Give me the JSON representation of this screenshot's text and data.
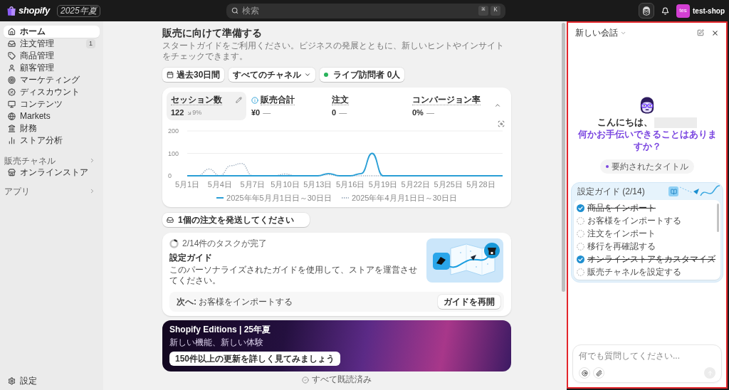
{
  "top_bar": {
    "logo": "shopify",
    "edition": "2025年夏",
    "search": {
      "placeholder": "検索",
      "keys": [
        "⌘",
        "K"
      ]
    },
    "avatar": "tes",
    "store": "test-shop"
  },
  "sidebar": {
    "items": [
      {
        "label": "ホーム",
        "selected": true
      },
      {
        "label": "注文管理",
        "selected": false,
        "badge": "1"
      },
      {
        "label": "商品管理",
        "selected": false
      },
      {
        "label": "顧客管理",
        "selected": false
      },
      {
        "label": "マーケティング",
        "selected": false
      },
      {
        "label": "ディスカウント",
        "selected": false
      },
      {
        "label": "コンテンツ",
        "selected": false
      },
      {
        "label": "Markets",
        "selected": false
      },
      {
        "label": "財務",
        "selected": false
      },
      {
        "label": "ストア分析",
        "selected": false
      }
    ],
    "sections": [
      {
        "title": "販売チャネル",
        "items": [
          {
            "label": "オンラインストア",
            "selected": false
          }
        ]
      },
      {
        "title": "アプリ"
      }
    ],
    "settings": {
      "label": "設定",
      "selected": false
    }
  },
  "main": {
    "title": "販売に向けて準備する",
    "subtitle": "スタートガイドをご利用ください。ビジネスの発展とともに、新しいヒントやインサイトをチェックできます。",
    "filters": [
      {
        "kind": "date",
        "label": "過去30日間"
      },
      {
        "kind": "dropdown",
        "label": "すべてのチャネル"
      },
      {
        "kind": "live",
        "label": "ライブ訪問者 0人"
      }
    ],
    "metrics": [
      {
        "label": "セッション数",
        "value": "122",
        "falling": true,
        "change": "9%",
        "selected": true
      },
      {
        "label": "販売合計",
        "info": true,
        "value": "¥0",
        "change": "—",
        "selected": false
      },
      {
        "label": "注文",
        "value": "0",
        "change": "—",
        "selected": false
      },
      {
        "label": "コンバージョン率",
        "value": "0%",
        "change": "—",
        "selected": false
      }
    ],
    "chart_data": {
      "type": "line",
      "categories": [
        "5月1日",
        null,
        null,
        "5月4日",
        null,
        null,
        "5月7日",
        null,
        null,
        "5月10日",
        null,
        null,
        "5月13日",
        null,
        null,
        "5月16日",
        null,
        null,
        "5月19日",
        null,
        null,
        "5月22日",
        null,
        null,
        "5月25日",
        null,
        null,
        "5月28日",
        null,
        null
      ],
      "ylim": [
        0,
        200
      ],
      "yticks": [
        0,
        100,
        200
      ],
      "series": [
        {
          "name": "2025年年5月月1日日～30日日",
          "color": "#2a9fd6",
          "line_style": "solid",
          "values": [
            0,
            0,
            0,
            0,
            0,
            0,
            0,
            0,
            0,
            0,
            0,
            0,
            0,
            10,
            0,
            0,
            10,
            100,
            0,
            0,
            0,
            0,
            0,
            0,
            0,
            0,
            0,
            0,
            0,
            0
          ]
        },
        {
          "name": "2025年年4月月1日日～30日日",
          "color": "#a9b7c6",
          "line_style": "dotted",
          "values": [
            0,
            0,
            30,
            0,
            45,
            55,
            0,
            0,
            0,
            8,
            0,
            0,
            0,
            5,
            0,
            0,
            0,
            0,
            0,
            null,
            null,
            null,
            null,
            null,
            null,
            null,
            null,
            null,
            null,
            null
          ]
        }
      ]
    },
    "notice": "1個の注文を発送してください",
    "setup_guide": {
      "progress": "2/14件のタスクが完了",
      "level": 0.14,
      "title": "設定ガイド",
      "description": "このパーソナライズされたガイドを使用して、ストアを運営させてください。",
      "next": "**次へ:** お客様をインポートする",
      "button": "ガイドを再開"
    },
    "banner": {
      "title": "Shopify Editions | 25年夏",
      "subtitle": "新しい機能、新しい体験",
      "button": "150件以上の更新を詳しく見てみましょう"
    },
    "footer": "すべて既読済み"
  },
  "assistant_panel": {
    "title": "新しい会話",
    "greeting": "こんにちは、",
    "prompt": "何かお手伝いできることはありますか？",
    "suggestion": "要約されたタイトル",
    "guide": {
      "title": "設定ガイド (2/14)",
      "tasks": [
        {
          "label": "商品をインポート",
          "checked": true
        },
        {
          "label": "お客様をインポートする",
          "checked": false
        },
        {
          "label": "注文をインポート",
          "checked": false
        },
        {
          "label": "移行を再確認する",
          "checked": false
        },
        {
          "label": "オンラインストアをカスタマイズ",
          "checked": true
        },
        {
          "label": "販売チャネルを設定する",
          "checked": false
        }
      ]
    },
    "input": {
      "placeholder": "何でも質問してください..."
    },
    "send_button": {
      "disabled": true
    }
  }
}
